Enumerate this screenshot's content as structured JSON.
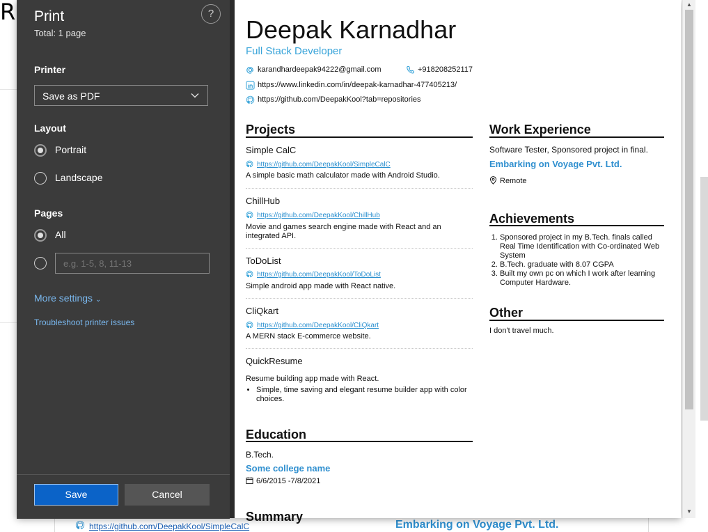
{
  "background": {
    "letter": "R",
    "bottom_link": "https://github.com/DeepakKool/SimpleCalC",
    "bottom_company": "Embarking on Voyage Pvt. Ltd."
  },
  "print_panel": {
    "title": "Print",
    "total": "Total: 1 page",
    "help_label": "?",
    "printer_label": "Printer",
    "printer_value": "Save as PDF",
    "layout_label": "Layout",
    "layout_options": [
      "Portrait",
      "Landscape"
    ],
    "layout_selected": "Portrait",
    "pages_label": "Pages",
    "pages_all": "All",
    "pages_placeholder": "e.g. 1-5, 8, 11-13",
    "more_settings": "More settings",
    "troubleshoot": "Troubleshoot printer issues",
    "save_label": "Save",
    "cancel_label": "Cancel"
  },
  "resume": {
    "name": "Deepak Karnadhar",
    "role": "Full Stack Developer",
    "email": "karandhardeepak94222@gmail.com",
    "phone": "+918208252117",
    "linkedin": "https://www.linkedin.com/in/deepak-karnadhar-477405213/",
    "github": "https://github.com/DeepakKool?tab=repositories",
    "projects_title": "Projects",
    "projects": [
      {
        "title": "Simple CalC",
        "link": "https://github.com/DeepakKool/SimpleCalC",
        "desc": "A simple basic math calculator made with Android Studio."
      },
      {
        "title": "ChillHub",
        "link": "https://github.com/DeepakKool/ChillHub",
        "desc": "Movie and games search engine made with React and an integrated API."
      },
      {
        "title": "ToDoList",
        "link": "https://github.com/DeepakKool/ToDoList",
        "desc": "Simple android app made with React native."
      },
      {
        "title": "CliQkart",
        "link": "https://github.com/DeepakKool/CliQkart",
        "desc": "A MERN stack E-commerce website."
      },
      {
        "title": "QuickResume",
        "desc": "Resume building app made with React.",
        "bullet": "Simple, time saving and elegant resume builder app with color choices."
      }
    ],
    "education_title": "Education",
    "education": {
      "degree": "B.Tech.",
      "college": "Some college name",
      "dates": "6/6/2015 -7/8/2021"
    },
    "summary_title": "Summary",
    "work_title": "Work Experience",
    "work": {
      "line": "Software Tester, Sponsored project in final.",
      "company": "Embarking on Voyage Pvt. Ltd.",
      "location": "Remote"
    },
    "achievements_title": "Achievements",
    "achievements": [
      "Sponsored project in my B.Tech. finals called Real Time Identification with Co-ordinated Web System",
      "B.Tech. graduate with 8.07 CGPA",
      "Built my own pc on which I work after learning Computer Hardware."
    ],
    "other_title": "Other",
    "other_text": "I don't travel much."
  },
  "colors": {
    "panel_bg": "#3b3b3b",
    "accent_blue": "#0b63c8",
    "link_blue": "#7ab8ef",
    "resume_accent": "#36a3d9"
  },
  "icons": [
    "help-icon",
    "chevron-down-icon",
    "email-icon",
    "phone-icon",
    "linkedin-icon",
    "github-icon",
    "location-icon",
    "calendar-icon"
  ]
}
